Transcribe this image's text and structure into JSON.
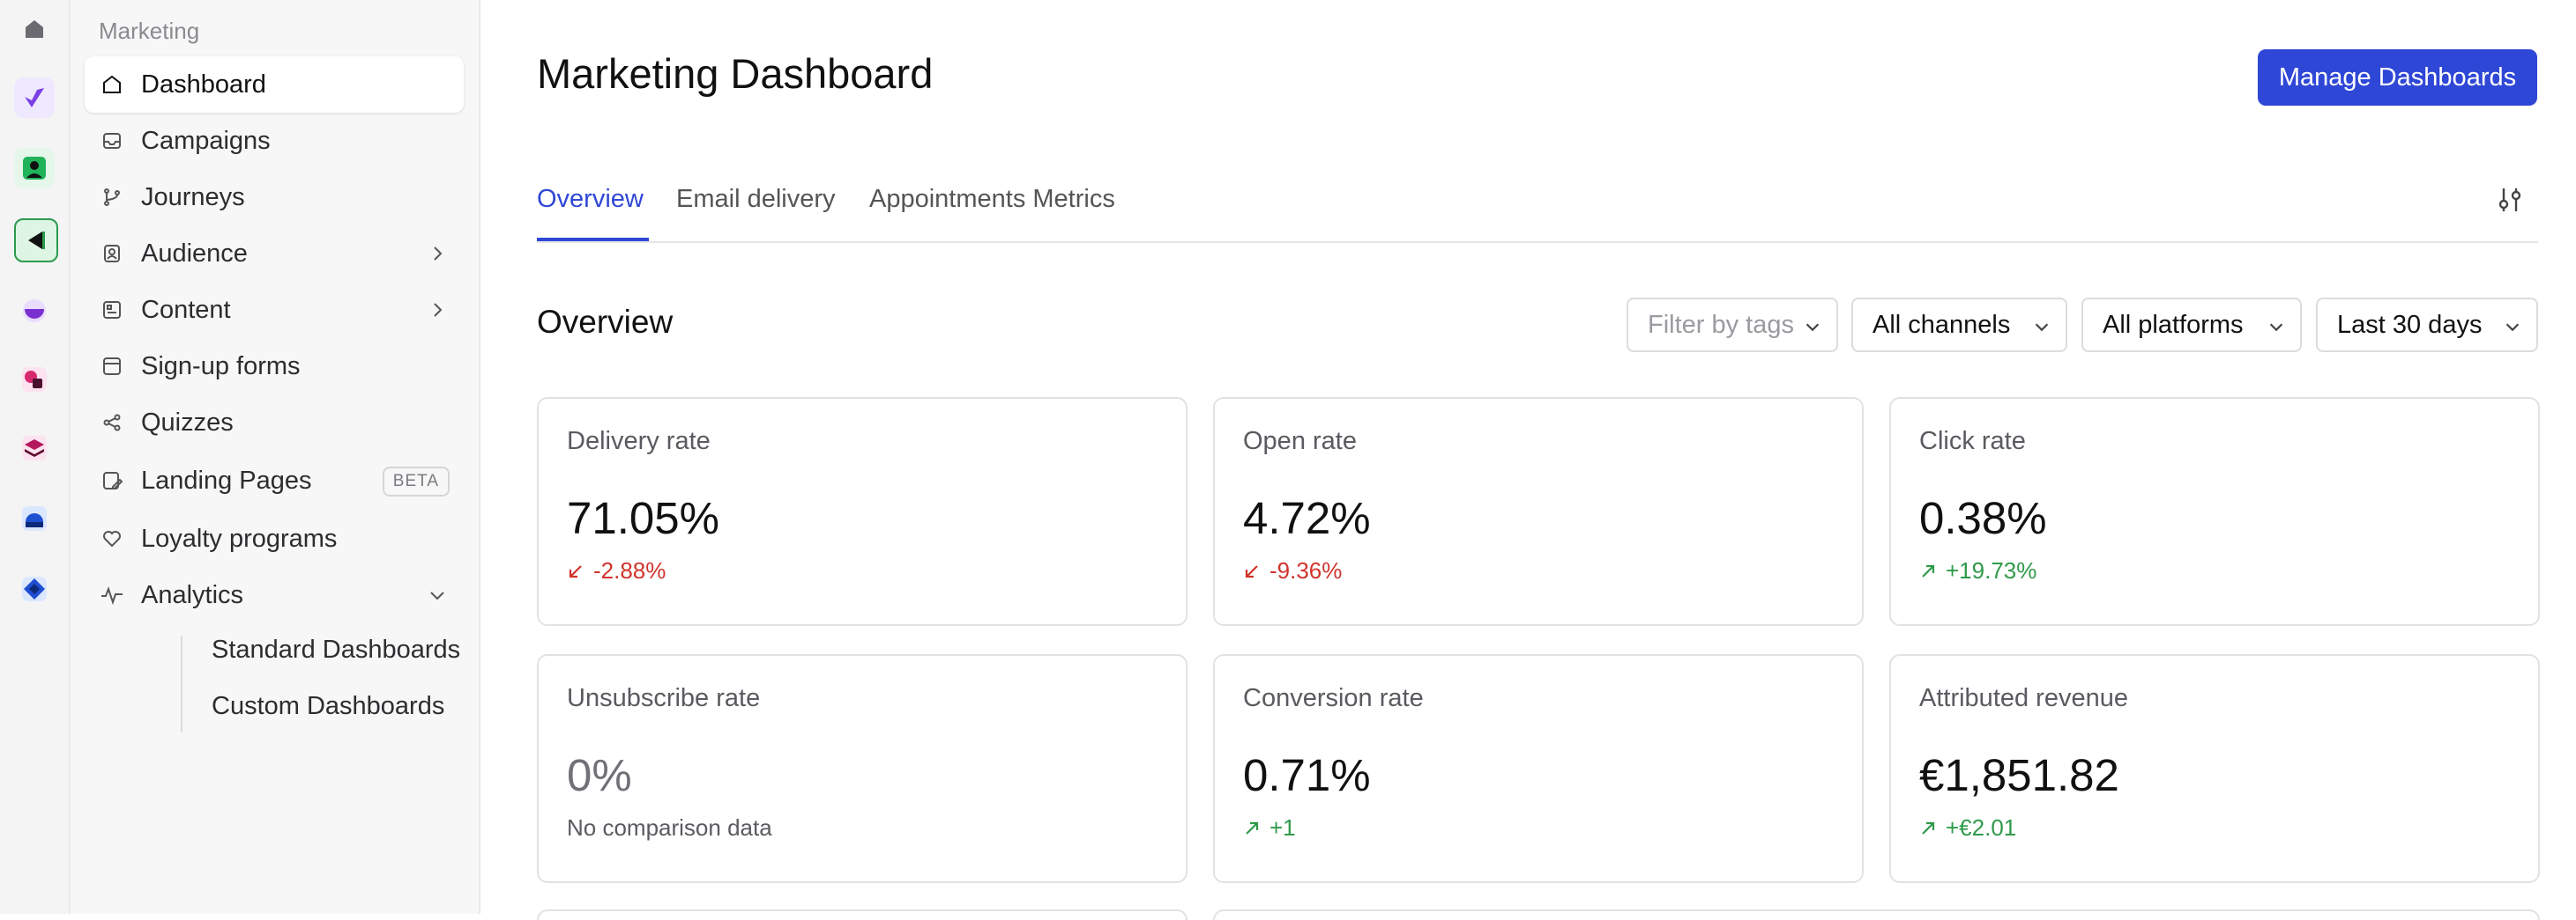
{
  "sidebar": {
    "section_label": "Marketing",
    "items": [
      {
        "label": "Dashboard"
      },
      {
        "label": "Campaigns"
      },
      {
        "label": "Journeys"
      },
      {
        "label": "Audience"
      },
      {
        "label": "Content"
      },
      {
        "label": "Sign-up forms"
      },
      {
        "label": "Quizzes"
      },
      {
        "label": "Landing Pages",
        "badge": "BETA"
      },
      {
        "label": "Loyalty programs"
      },
      {
        "label": "Analytics"
      }
    ],
    "analytics_sub": [
      {
        "label": "Standard Dashboards"
      },
      {
        "label": "Custom Dashboards"
      }
    ]
  },
  "header": {
    "title": "Marketing Dashboard",
    "manage_button": "Manage Dashboards"
  },
  "tabs": [
    {
      "label": "Overview"
    },
    {
      "label": "Email delivery"
    },
    {
      "label": "Appointments Metrics"
    }
  ],
  "overview": {
    "title": "Overview",
    "filters": {
      "tags_placeholder": "Filter by tags",
      "channels": "All channels",
      "platforms": "All platforms",
      "period": "Last 30 days"
    },
    "cards": [
      {
        "label": "Delivery rate",
        "value": "71.05%",
        "delta": "-2.88%"
      },
      {
        "label": "Open rate",
        "value": "4.72%",
        "delta": "-9.36%"
      },
      {
        "label": "Click rate",
        "value": "0.38%",
        "delta": "+19.73%"
      },
      {
        "label": "Unsubscribe rate",
        "value": "0%",
        "delta": "No comparison data"
      },
      {
        "label": "Conversion rate",
        "value": "0.71%",
        "delta": "+1"
      },
      {
        "label": "Attributed revenue",
        "value": "€1,851.82",
        "delta": "+€2.01"
      }
    ]
  },
  "colors": {
    "accent": "#2f47d6",
    "negative": "#d0342c",
    "positive": "#2f9a4a"
  }
}
